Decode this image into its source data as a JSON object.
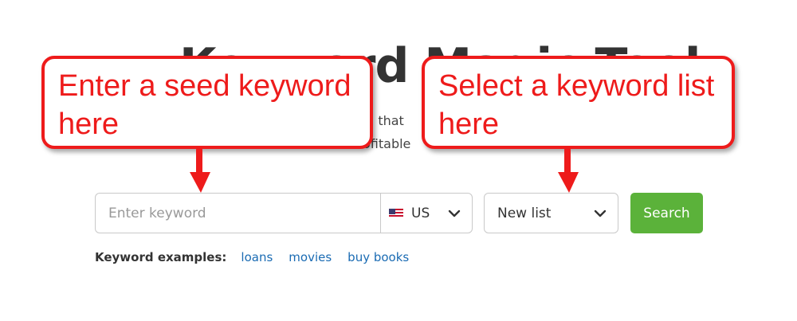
{
  "page": {
    "title": "Keyword Magic Tool",
    "subtitle_line1": "ol that",
    "subtitle_line2": "ofitable"
  },
  "search": {
    "keyword_placeholder": "Enter keyword",
    "country": {
      "flag_icon": "us-flag-icon",
      "value": "US"
    },
    "list_select": {
      "value": "New list"
    },
    "button_label": "Search",
    "button_color": "#5bb23a"
  },
  "examples": {
    "label": "Keyword examples:",
    "links": [
      "loans",
      "movies",
      "buy books"
    ],
    "link_color": "#1a6bb3"
  },
  "callouts": {
    "left": {
      "line1": "Enter a seed keyword",
      "line2": "here"
    },
    "right": {
      "line1": "Select a keyword list",
      "line2": "here"
    },
    "color": "#ee1b1b"
  }
}
